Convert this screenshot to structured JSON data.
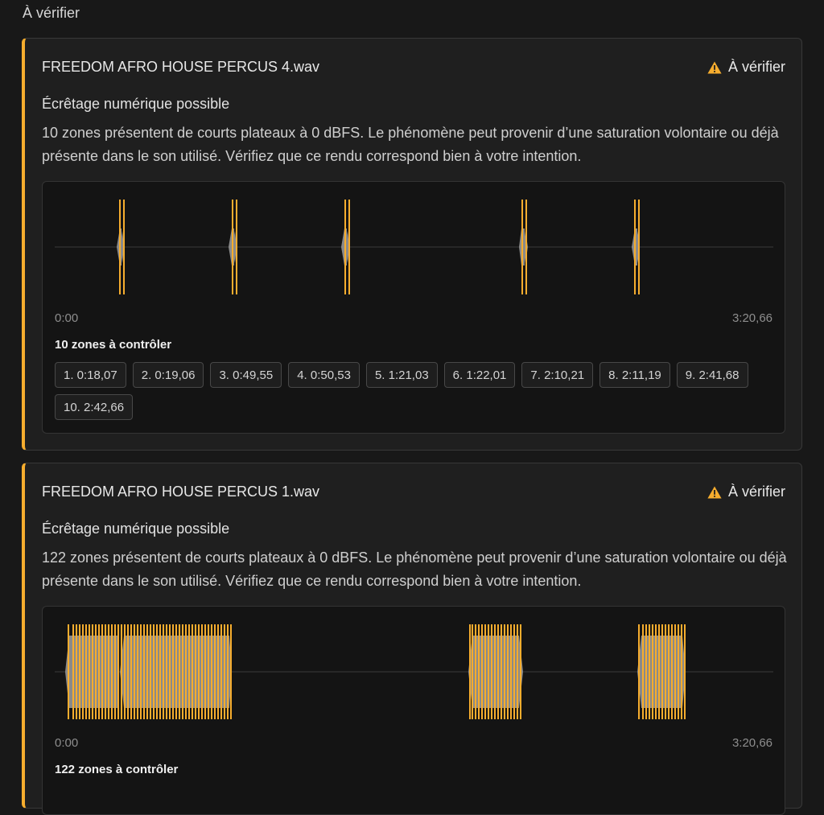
{
  "section": {
    "title": "À vérifier"
  },
  "cards": [
    {
      "file_name": "FREEDOM AFRO HOUSE PERCUS 4.wav",
      "status": "À vérifier",
      "issue_title": "Écrêtage numérique possible",
      "description": "10 zones présentent de courts plateaux à 0 dBFS. Le phénomène peut provenir d’une saturation volontaire ou déjà présente dans le son utilisé. Vérifiez que ce rendu correspond bien à votre intention.",
      "time_start": "0:00",
      "time_end": "3:20,66",
      "zones_count": "10 zones à contrôler",
      "zones": [
        "1. 0:18,07",
        "2. 0:19,06",
        "3. 0:49,55",
        "4. 0:50,53",
        "5. 1:21,03",
        "6. 1:22,01",
        "7. 2:10,21",
        "8. 2:11,19",
        "9. 2:41,68",
        "10. 2:42,66"
      ]
    },
    {
      "file_name": "FREEDOM AFRO HOUSE PERCUS 1.wav",
      "status": "À vérifier",
      "issue_title": "Écrêtage numérique possible",
      "description": "122 zones présentent de courts plateaux à 0 dBFS. Le phénomène peut provenir d’une saturation volontaire ou déjà présente dans le son utilisé. Vérifiez que ce rendu correspond bien à votre intention.",
      "time_start": "0:00",
      "time_end": "3:20,66",
      "zones_count": "122 zones à contrôler"
    }
  ],
  "colors": {
    "accent": "#f6ad2e",
    "waveform": "#8a8a8a",
    "background": "#181818"
  },
  "icons": {
    "status": "warning-triangle-icon"
  }
}
